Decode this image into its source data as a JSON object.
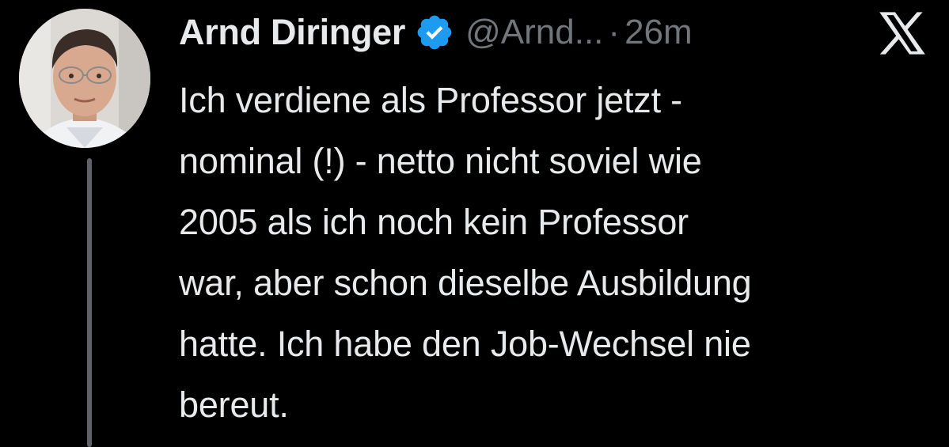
{
  "author": {
    "display_name": "Arnd Diringer",
    "verified": true,
    "verified_color": "#1d9bf0",
    "handle": "@Arnd...",
    "separator": "·",
    "timestamp": "26m",
    "avatar_icon": "profile-photo"
  },
  "platform_icon": "x-logo-icon",
  "tweet": {
    "text": "Ich verdiene als Professor jetzt -\nnominal (!) - netto nicht soviel wie\n2005 als ich noch kein Professor\nwar, aber schon dieselbe Ausbildung\nhatte. Ich habe den Job-Wechsel nie\nbereut."
  },
  "colors": {
    "background": "#000000",
    "primary_text": "#e7e9ea",
    "secondary_text": "#71767b",
    "thread_line": "#5f6368"
  }
}
